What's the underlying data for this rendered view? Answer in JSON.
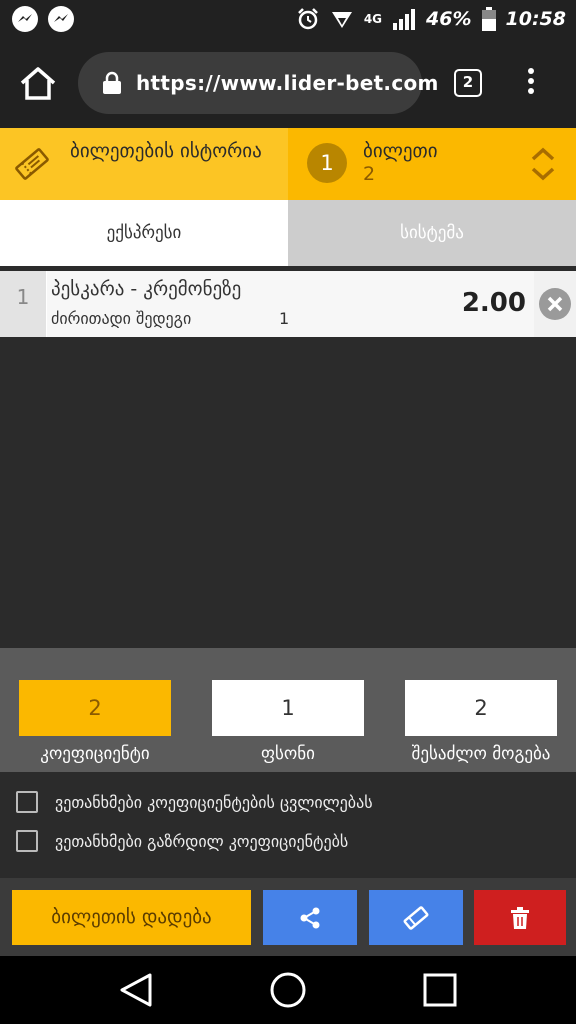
{
  "status_bar": {
    "network_label": "4G",
    "battery": "46%",
    "time": "10:58"
  },
  "browser": {
    "url": "https://www.lider-bet.com",
    "tab_count": "2"
  },
  "ticket_header": {
    "history_label": "ბილეთების ისტორია",
    "ticket_number": "1",
    "ticket_title": "ბილეთი",
    "ticket_sub": "2"
  },
  "mode_tabs": {
    "express": "ექსპრესი",
    "system": "სისტემა"
  },
  "bets": [
    {
      "index": "1",
      "match": "პესკარა - კრემონეზე",
      "market": "ძირითადი შედეგი",
      "pick": "1",
      "odd": "2.00"
    }
  ],
  "stake": {
    "coefficient_value": "2",
    "coefficient_label": "კოეფიციენტი",
    "price_value": "1",
    "price_label": "ფსონი",
    "win_value": "2",
    "win_label": "შესაძლო მოგება"
  },
  "agreements": [
    "ვეთანხმები კოეფიციენტების ცვლილებას",
    "ვეთანხმები გაზრდილ კოეფიციენტებს"
  ],
  "actions": {
    "place_label": "ბილეთის დადება"
  },
  "colors": {
    "accent": "#fbb800",
    "accent_light": "#fcc524",
    "blue": "#4682e8",
    "red": "#cf1f1f"
  }
}
